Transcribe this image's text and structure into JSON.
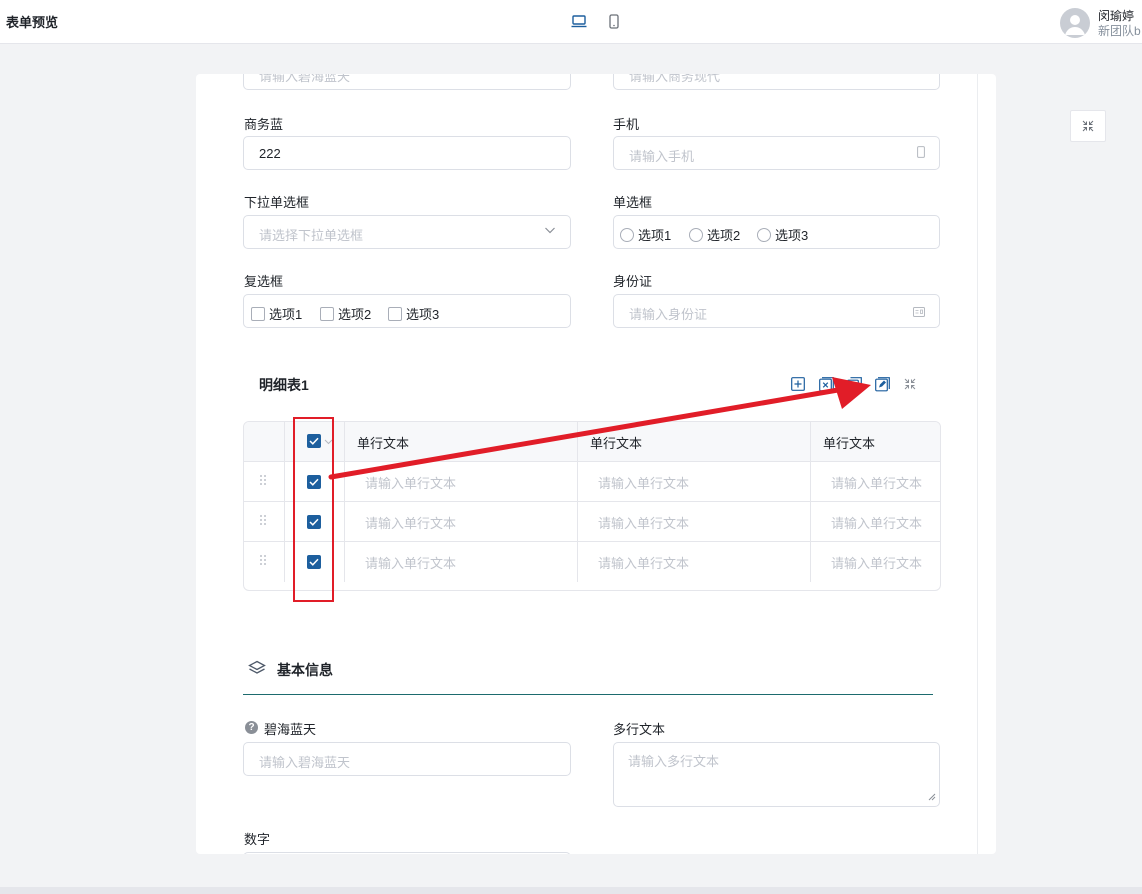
{
  "header": {
    "title": "表单预览",
    "user_name": "闵瑜婷",
    "user_team": "新团队b"
  },
  "colors": {
    "accent": "#1d5f9e",
    "annotation": "#e11d28",
    "section_line": "#1d6b6e"
  },
  "form": {
    "top_partial": [
      {
        "placeholder": "请输入碧海蓝天"
      },
      {
        "placeholder": "请输入商务现代"
      }
    ],
    "business_blue": {
      "label": "商务蓝",
      "value": "222"
    },
    "phone": {
      "label": "手机",
      "placeholder": "请输入手机"
    },
    "dropdown": {
      "label": "下拉单选框",
      "placeholder": "请选择下拉单选框"
    },
    "radio": {
      "label": "单选框",
      "options": [
        "选项1",
        "选项2",
        "选项3"
      ]
    },
    "checkbox": {
      "label": "复选框",
      "options": [
        "选项1",
        "选项2",
        "选项3"
      ]
    },
    "id_card": {
      "label": "身份证",
      "placeholder": "请输入身份证"
    }
  },
  "detail_table": {
    "title": "明细表1",
    "columns": [
      "单行文本",
      "单行文本",
      "单行文本"
    ],
    "rows": [
      [
        "请输入单行文本",
        "请输入单行文本",
        "请输入单行文本"
      ],
      [
        "请输入单行文本",
        "请输入单行文本",
        "请输入单行文本"
      ],
      [
        "请输入单行文本",
        "请输入单行文本",
        "请输入单行文本"
      ]
    ]
  },
  "basic_info": {
    "title": "基本信息",
    "sea_sky": {
      "label": "碧海蓝天",
      "placeholder": "请输入碧海蓝天"
    },
    "multiline": {
      "label": "多行文本",
      "placeholder": "请输入多行文本"
    },
    "number": {
      "label": "数字"
    }
  }
}
